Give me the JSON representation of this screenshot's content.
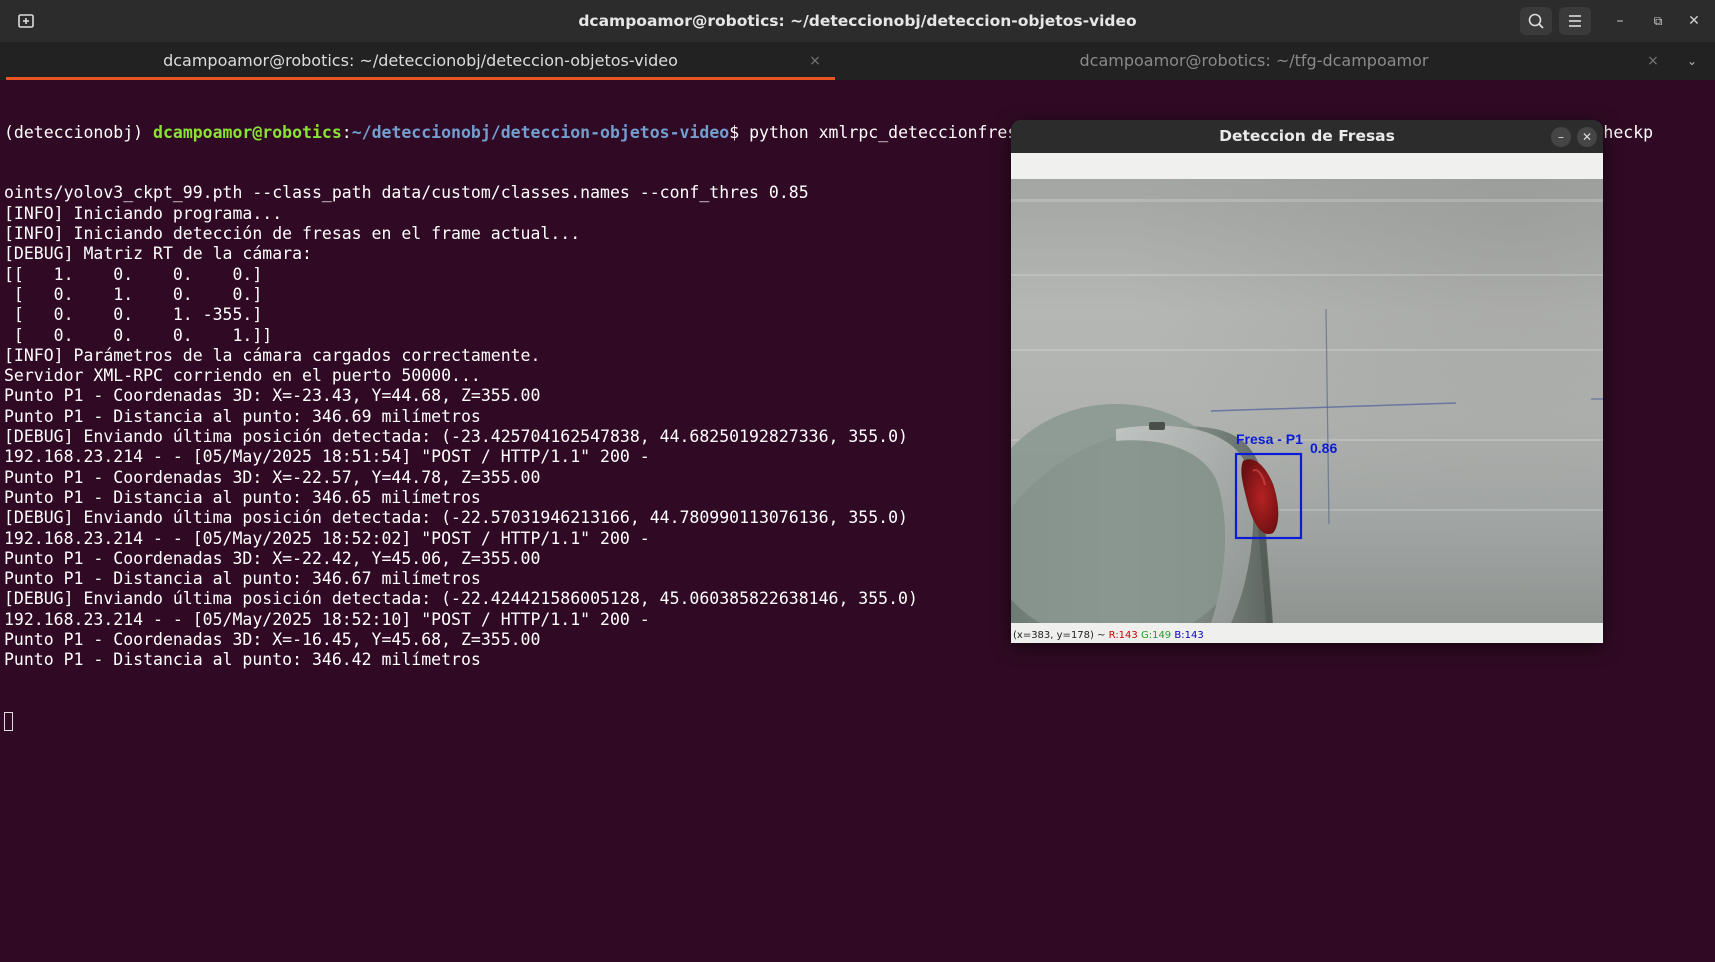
{
  "window": {
    "title": "dcampoamor@robotics: ~/deteccionobj/deteccion-objetos-video",
    "icons": {
      "new_tab": "terminal-new-tab-icon",
      "search": "search-icon",
      "menu": "hamburger-menu-icon",
      "minimize": "minimize-icon",
      "restore": "restore-icon",
      "close": "close-icon"
    },
    "controls": {
      "minimize": "–",
      "restore": "⧉",
      "close": "✕"
    }
  },
  "tabs": [
    {
      "label": "dcampoamor@robotics: ~/deteccionobj/deteccion-objetos-video",
      "close": "×",
      "active": true
    },
    {
      "label": "dcampoamor@robotics: ~/tfg-dcampoamor",
      "close": "×",
      "active": false
    }
  ],
  "tab_overflow": "⌄",
  "terminal": {
    "prompt": {
      "env": "(deteccionobj) ",
      "user": "dcampoamor@robotics",
      "sep": ":",
      "path": "~/deteccionobj/deteccion-objetos-video",
      "dollar": "$ ",
      "command": "python xmlrpc_deteccionfresas.py --model_def config/yolov3-custom.cfg --weights_path checkp"
    },
    "lines": [
      "oints/yolov3_ckpt_99.pth --class_path data/custom/classes.names --conf_thres 0.85",
      "[INFO] Iniciando programa...",
      "[INFO] Iniciando detección de fresas en el frame actual...",
      "[DEBUG] Matriz RT de la cámara:",
      "[[   1.    0.    0.    0.]",
      " [   0.    1.    0.    0.]",
      " [   0.    0.    1. -355.]",
      " [   0.    0.    0.    1.]]",
      "[INFO] Parámetros de la cámara cargados correctamente.",
      "Servidor XML-RPC corriendo en el puerto 50000...",
      "Punto P1 - Coordenadas 3D: X=-23.43, Y=44.68, Z=355.00",
      "Punto P1 - Distancia al punto: 346.69 milímetros",
      "[DEBUG] Enviando última posición detectada: (-23.425704162547838, 44.68250192827336, 355.0)",
      "192.168.23.214 - - [05/May/2025 18:51:54] \"POST / HTTP/1.1\" 200 -",
      "Punto P1 - Coordenadas 3D: X=-22.57, Y=44.78, Z=355.00",
      "Punto P1 - Distancia al punto: 346.65 milímetros",
      "[DEBUG] Enviando última posición detectada: (-22.57031946213166, 44.780990113076136, 355.0)",
      "192.168.23.214 - - [05/May/2025 18:52:02] \"POST / HTTP/1.1\" 200 -",
      "Punto P1 - Coordenadas 3D: X=-22.42, Y=45.06, Z=355.00",
      "Punto P1 - Distancia al punto: 346.67 milímetros",
      "[DEBUG] Enviando última posición detectada: (-22.424421586005128, 45.060385822638146, 355.0)",
      "192.168.23.214 - - [05/May/2025 18:52:10] \"POST / HTTP/1.1\" 200 -",
      "Punto P1 - Coordenadas 3D: X=-16.45, Y=45.68, Z=355.00",
      "Punto P1 - Distancia al punto: 346.42 milímetros"
    ]
  },
  "viewer": {
    "title": "Deteccion de Fresas",
    "minimize": "–",
    "close": "✕",
    "detection": {
      "label": "Fresa - P1",
      "confidence": "0.86",
      "box_color": "#0a1cd8"
    },
    "status": {
      "coords": "(x=383, y=178) ~ ",
      "r": "R:143",
      "g": "G:149",
      "b": "B:143"
    }
  },
  "colors": {
    "terminal_bg": "#300a24",
    "prompt_user": "#8ae234",
    "prompt_path": "#729fcf",
    "tab_accent": "#e95420"
  }
}
